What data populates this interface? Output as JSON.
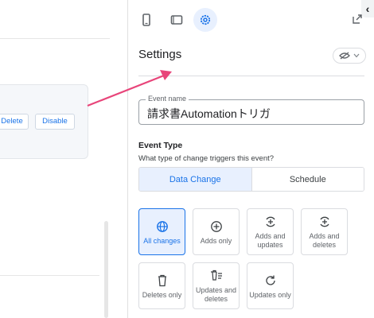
{
  "left": {
    "delete_label": "Delete",
    "disable_label": "Disable"
  },
  "toolbar": {
    "icons": [
      "phone-icon",
      "tablet-icon",
      "gear-icon"
    ],
    "collapse_glyph": "‹",
    "expand_icon": "expand-icon"
  },
  "settings": {
    "title": "Settings",
    "toggle_icon": "eye-off-icon"
  },
  "event_name": {
    "label": "Event name",
    "value": "請求書Automationトリガ"
  },
  "event_type": {
    "title": "Event Type",
    "subtitle": "What type of change triggers this event?",
    "tabs": [
      {
        "label": "Data Change",
        "selected": true
      },
      {
        "label": "Schedule",
        "selected": false
      }
    ]
  },
  "change_options": [
    {
      "label": "All changes",
      "icon": "globe-icon",
      "selected": true
    },
    {
      "label": "Adds only",
      "icon": "plus-circle-icon",
      "selected": false
    },
    {
      "label": "Adds and updates",
      "icon": "plus-circle-arrows-icon",
      "selected": false
    },
    {
      "label": "Adds and deletes",
      "icon": "plus-circle-arrows-icon",
      "selected": false
    },
    {
      "label": "Deletes only",
      "icon": "trash-icon",
      "selected": false
    },
    {
      "label": "Updates and deletes",
      "icon": "trash-list-icon",
      "selected": false
    },
    {
      "label": "Updates only",
      "icon": "refresh-icon",
      "selected": false
    }
  ],
  "colors": {
    "accent": "#1a73e8",
    "accent_bg": "#e8f0fe",
    "annotation_arrow": "#e8457a"
  }
}
